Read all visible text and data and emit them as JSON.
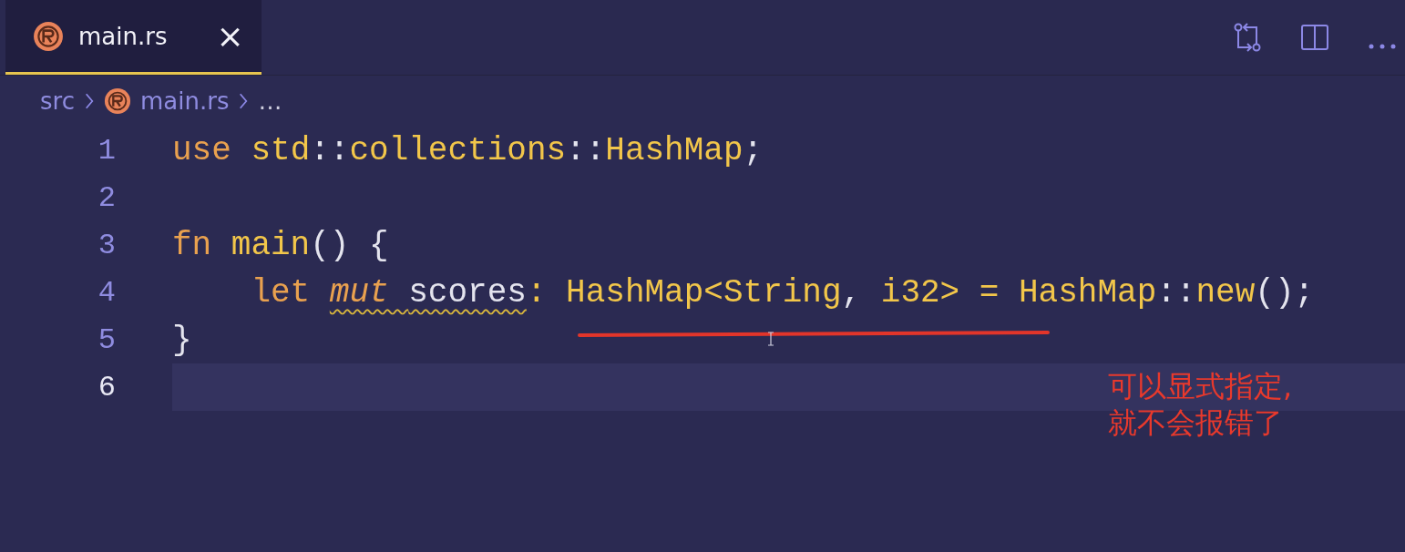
{
  "tabs": [
    {
      "label": "main.rs",
      "selected": true,
      "close": "×"
    }
  ],
  "breadcrumb": [
    {
      "label": "src",
      "kind": "folder"
    },
    {
      "label": "main.rs",
      "kind": "file"
    },
    {
      "label": "…",
      "kind": "more"
    }
  ],
  "lines": [
    {
      "number": "1",
      "current": false,
      "tokens": [
        {
          "text": "use ",
          "kind": "keyword"
        },
        {
          "text": "std",
          "kind": "path"
        },
        {
          "text": "::",
          "kind": "punct"
        },
        {
          "text": "collections",
          "kind": "path"
        },
        {
          "text": "::",
          "kind": "punct"
        },
        {
          "text": "HashMap",
          "kind": "type"
        },
        {
          "text": ";",
          "kind": "punct"
        }
      ]
    },
    {
      "number": "2",
      "current": false
    },
    {
      "number": "3",
      "current": false,
      "tokens": [
        {
          "text": "fn ",
          "kind": "keyword"
        },
        {
          "text": "main",
          "kind": "function"
        },
        {
          "text": "() {",
          "kind": "punct"
        }
      ]
    },
    {
      "number": "4",
      "current": false,
      "indented": true,
      "tokens": [
        {
          "text": "let ",
          "kind": "keyword"
        },
        {
          "text": "mut ",
          "kind": "modifier",
          "warning": true
        },
        {
          "text": "scores",
          "kind": "variable",
          "warning": true
        },
        {
          "text": ": ",
          "kind": "operator"
        },
        {
          "text": "HashMap",
          "kind": "type"
        },
        {
          "text": "<",
          "kind": "type"
        },
        {
          "text": "String",
          "kind": "type"
        },
        {
          "text": ", ",
          "kind": "punct"
        },
        {
          "text": "i32",
          "kind": "type"
        },
        {
          "text": ">",
          "kind": "type"
        },
        {
          "text": " = ",
          "kind": "operator"
        },
        {
          "text": "HashMap",
          "kind": "type"
        },
        {
          "text": "::",
          "kind": "punct"
        },
        {
          "text": "new",
          "kind": "function"
        },
        {
          "text": "();",
          "kind": "punct"
        }
      ]
    },
    {
      "number": "5",
      "current": false,
      "tokens": [
        {
          "text": "}",
          "kind": "punct"
        }
      ]
    },
    {
      "number": "6",
      "current": true
    }
  ],
  "annotation": {
    "lines": [
      "可以显式指定,",
      "就不会报错了"
    ]
  }
}
